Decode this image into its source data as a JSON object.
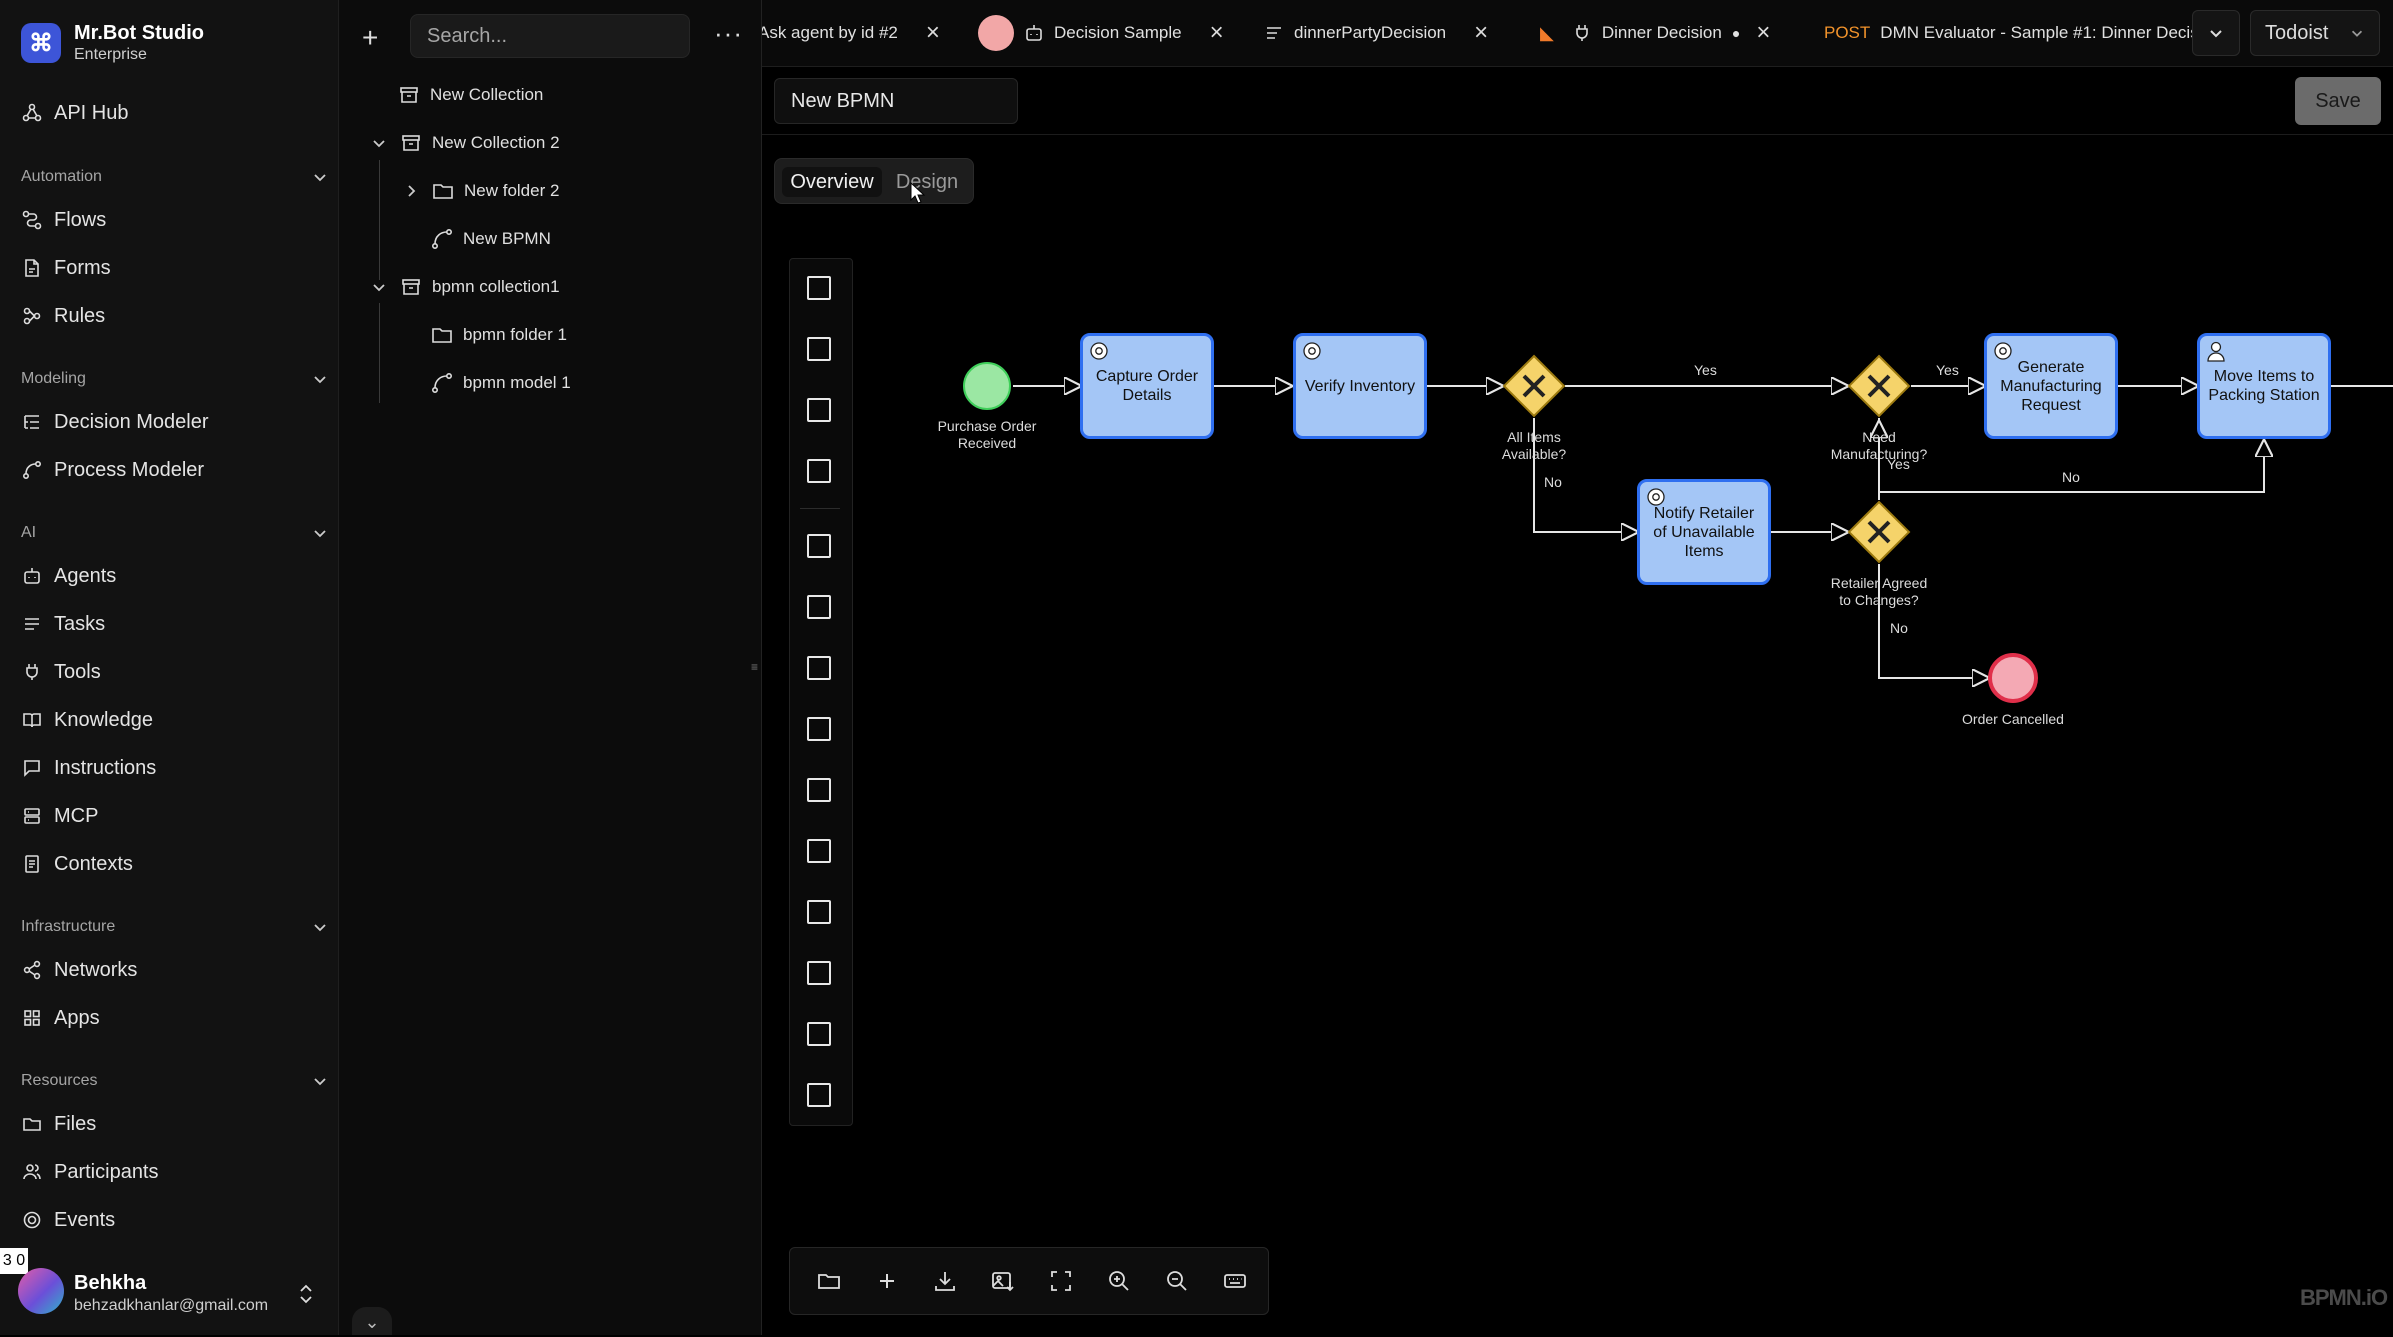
{
  "brand": {
    "name": "Mr.Bot Studio",
    "plan": "Enterprise",
    "logo_icon": "command-icon",
    "accent": "#3d55d8"
  },
  "sidebar": {
    "api_hub": "API Hub",
    "sections": [
      {
        "title": "Automation",
        "items": [
          "Flows",
          "Forms",
          "Rules"
        ]
      },
      {
        "title": "Modeling",
        "items": [
          "Decision Modeler",
          "Process Modeler"
        ]
      },
      {
        "title": "AI",
        "items": [
          "Agents",
          "Tasks",
          "Tools",
          "Knowledge",
          "Instructions",
          "MCP",
          "Contexts"
        ]
      },
      {
        "title": "Infrastructure",
        "items": [
          "Networks",
          "Apps"
        ]
      },
      {
        "title": "Resources",
        "items": [
          "Files",
          "Participants",
          "Events"
        ]
      }
    ]
  },
  "user": {
    "name": "Behkha",
    "email": "behzadkhanlar@gmail.com"
  },
  "badge_counter": "3 0",
  "tree": {
    "search_placeholder": "Search...",
    "items": [
      {
        "label": "New Collection"
      },
      {
        "label": "New Collection 2"
      },
      {
        "label": "New folder 2"
      },
      {
        "label": "New BPMN"
      },
      {
        "label": "bpmn collection1"
      },
      {
        "label": "bpmn folder 1"
      },
      {
        "label": "bpmn model 1"
      }
    ]
  },
  "tabs": [
    {
      "label": "Ask agent by id #2"
    },
    {
      "label": "Decision Sample"
    },
    {
      "label": "dinnerPartyDecision"
    },
    {
      "label": "Dinner Decision"
    },
    {
      "method": "POST",
      "label": "DMN Evaluator - Sample #1: Dinner Decis"
    }
  ],
  "workspace": "Todoist",
  "editor": {
    "name_value": "New BPMN",
    "save_label": "Save",
    "view_tabs": [
      "Overview",
      "Design"
    ],
    "active_view": "Overview"
  },
  "diagram": {
    "start_event": "Purchase Order\nReceived",
    "tasks": {
      "capture": "Capture Order Details",
      "verify": "Verify Inventory",
      "generate": "Generate Manufacturing Request",
      "move": "Move Items to Packing Station",
      "notify": "Notify Retailer of Unavailable Items"
    },
    "gateways": {
      "all_items": "All Items\nAvailable?",
      "need_mfg": "Need\nManufacturing?",
      "retailer": "Retailer Agreed\nto Changes?"
    },
    "end_event": "Order Cancelled",
    "flow_labels": {
      "yes1": "Yes",
      "yes2": "Yes",
      "yes3": "Yes",
      "no1": "No",
      "no2": "No",
      "no3": "No"
    }
  },
  "watermark": "BPMN.iO"
}
